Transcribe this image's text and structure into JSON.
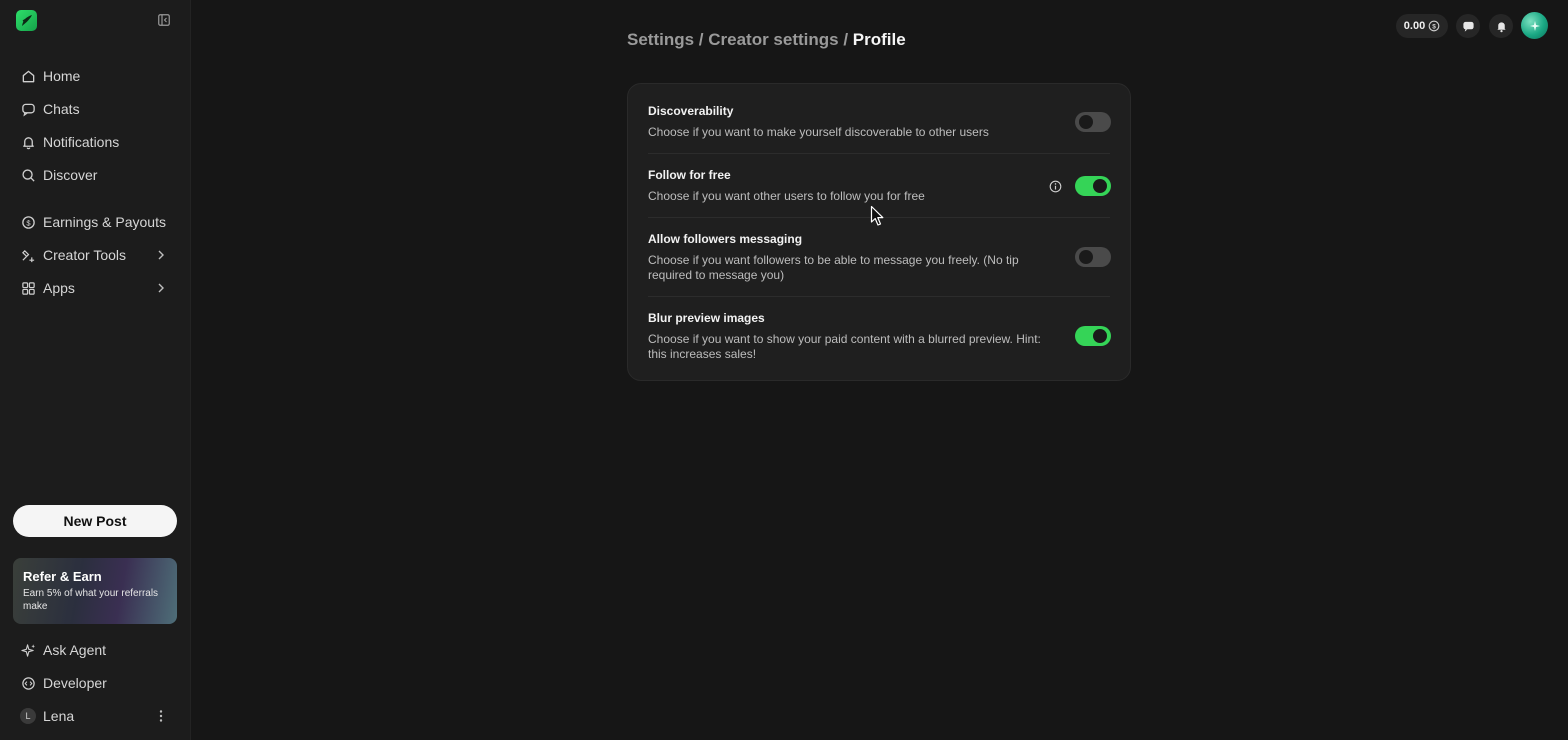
{
  "sidebar": {
    "nav": [
      {
        "label": "Home",
        "icon": "home-icon"
      },
      {
        "label": "Chats",
        "icon": "chat-icon"
      },
      {
        "label": "Notifications",
        "icon": "bell-icon"
      },
      {
        "label": "Discover",
        "icon": "search-icon"
      },
      {
        "label": "Earnings & Payouts",
        "icon": "dollar-circle-icon"
      },
      {
        "label": "Creator Tools",
        "icon": "creator-tools-icon"
      },
      {
        "label": "Apps",
        "icon": "apps-grid-icon"
      }
    ],
    "new_post_label": "New Post",
    "refer": {
      "title": "Refer & Earn",
      "text": "Earn 5% of what your referrals make"
    },
    "bottom": [
      {
        "label": "Ask Agent",
        "icon": "sparkle-icon"
      },
      {
        "label": "Developer",
        "icon": "code-icon"
      }
    ],
    "user": {
      "initial": "L",
      "name": "Lena"
    }
  },
  "topbar": {
    "balance": "0.00"
  },
  "breadcrumb": {
    "part1": "Settings / ",
    "part2": "Creator settings / ",
    "current": "Profile"
  },
  "settings": [
    {
      "title": "Discoverability",
      "description": "Choose if you want to make yourself discoverable to other users",
      "enabled": false
    },
    {
      "title": "Follow for free",
      "description": "Choose if you want other users to follow you for free",
      "enabled": true
    },
    {
      "title": "Allow followers messaging",
      "description": "Choose if you want followers to be able to message you freely. (No tip required to message you)",
      "enabled": false
    },
    {
      "title": "Blur preview images",
      "description": "Choose if you want to show your paid content with a blurred preview. Hint: this increases sales!",
      "enabled": true
    }
  ],
  "colors": {
    "accent": "#35d457",
    "background": "#161616",
    "sidebar": "#1c1c1c",
    "card": "#1f1f1f"
  }
}
